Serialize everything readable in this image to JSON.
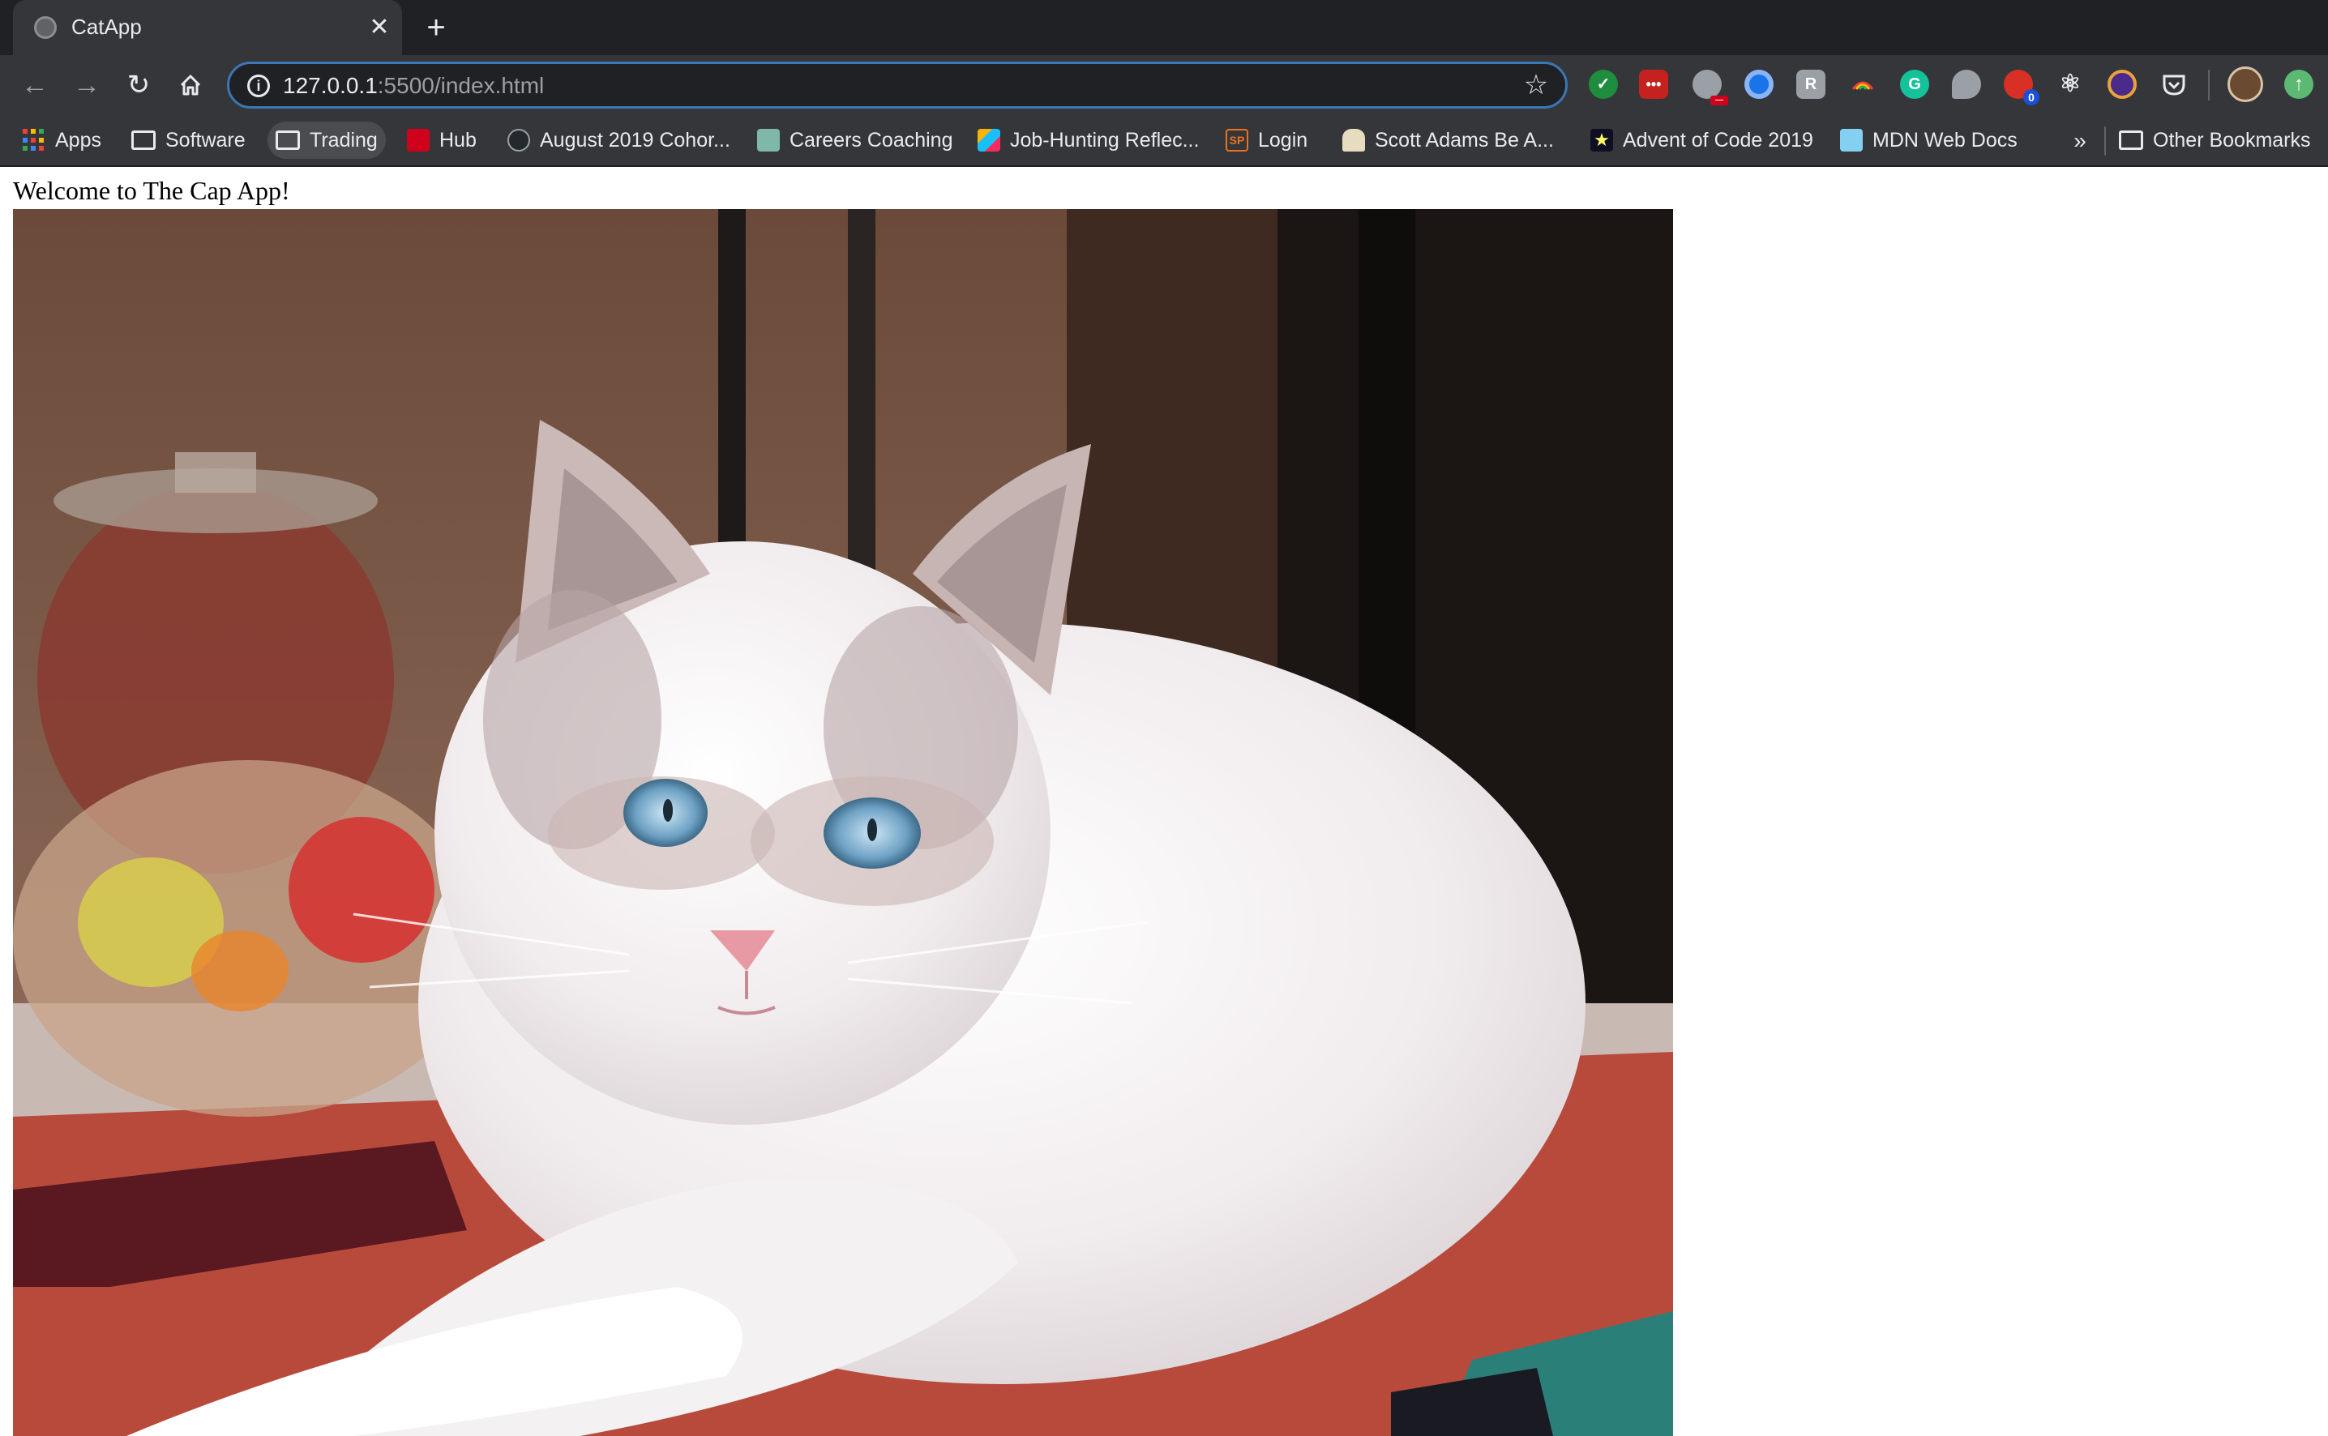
{
  "tab": {
    "title": "CatApp",
    "close_icon": "close-icon",
    "new_tab_icon": "plus-icon"
  },
  "toolbar": {
    "url_host": "127.0.0.1",
    "url_rest": ":5500/index.html",
    "extensions": [
      {
        "name": "checkmark-extension-icon",
        "color": "#1e8e3e"
      },
      {
        "name": "red-dots-extension-icon",
        "color": "#c5221f"
      },
      {
        "name": "face-extension-icon",
        "color": "#9aa0a6",
        "badge": "—"
      },
      {
        "name": "blue-circle-extension-icon",
        "color": "#1a73e8"
      },
      {
        "name": "r-extension-icon",
        "color": "#9aa0a6"
      },
      {
        "name": "rainbow-extension-icon",
        "color": "#5f6368"
      },
      {
        "name": "grammarly-extension-icon",
        "color": "#15c39a"
      },
      {
        "name": "speech-bubble-extension-icon",
        "color": "#9aa0a6"
      },
      {
        "name": "red-shield-extension-icon",
        "color": "#d93025",
        "badge": "0"
      },
      {
        "name": "react-devtools-extension-icon",
        "color": "#35363a"
      },
      {
        "name": "purple-globe-extension-icon",
        "color": "#4a2a8a"
      },
      {
        "name": "pocket-extension-icon",
        "color": "#35363a"
      }
    ]
  },
  "bookmarks": [
    {
      "label": "Apps",
      "icon": "apps-grid-icon"
    },
    {
      "label": "Software",
      "icon": "folder-icon"
    },
    {
      "label": "Trading",
      "icon": "folder-icon"
    },
    {
      "label": "Hub",
      "icon": "hub-icon"
    },
    {
      "label": "August 2019 Cohor...",
      "icon": "github-icon"
    },
    {
      "label": "Careers Coaching",
      "icon": "careers-icon"
    },
    {
      "label": "Job-Hunting Reflec...",
      "icon": "airtable-icon"
    },
    {
      "label": "Login",
      "icon": "sp-icon"
    },
    {
      "label": "Scott Adams Be A...",
      "icon": "figure-icon"
    },
    {
      "label": "Advent of Code 2019",
      "icon": "star-icon"
    },
    {
      "label": "MDN Web Docs",
      "icon": "mdn-icon"
    }
  ],
  "other_bookmarks": {
    "label": "Other Bookmarks",
    "icon": "folder-icon"
  },
  "page": {
    "welcome": "Welcome to The Cap App!"
  },
  "colors": {
    "tabstrip": "#202124",
    "toolbar": "#35363a",
    "omnibox_border": "#3c76b5"
  }
}
